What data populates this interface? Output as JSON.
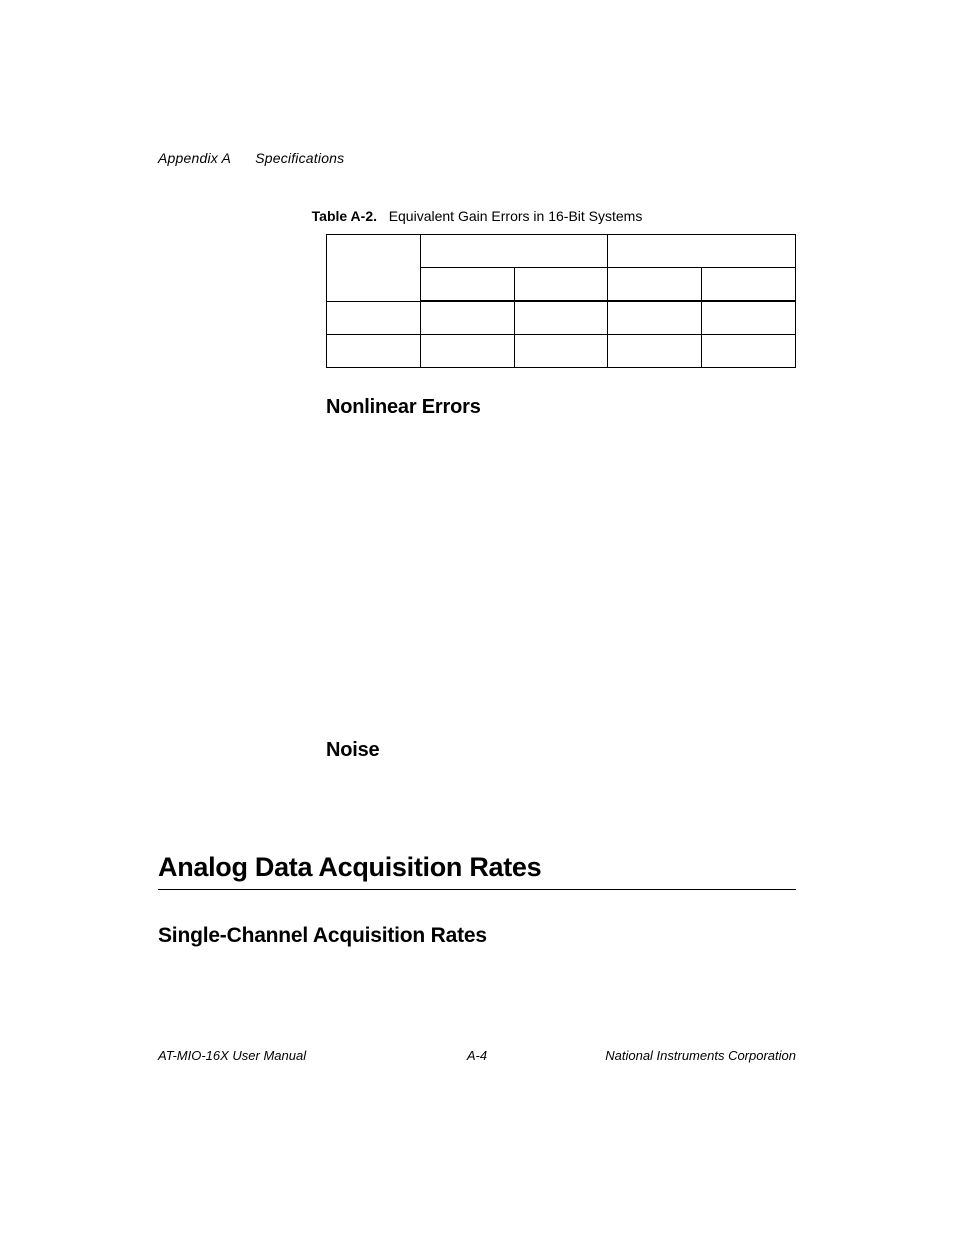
{
  "header": {
    "appendix": "Appendix A",
    "section": "Specifications"
  },
  "table": {
    "caption_label": "Table A-2.",
    "caption_text": "Equivalent Gain Errors in 16-Bit Systems"
  },
  "headings": {
    "nonlinear": "Nonlinear Errors",
    "noise": "Noise",
    "main": "Analog Data Acquisition Rates",
    "sub": "Single-Channel Acquisition Rates"
  },
  "footer": {
    "left": "AT-MIO-16X User Manual",
    "center": "A-4",
    "right": "National Instruments Corporation"
  }
}
